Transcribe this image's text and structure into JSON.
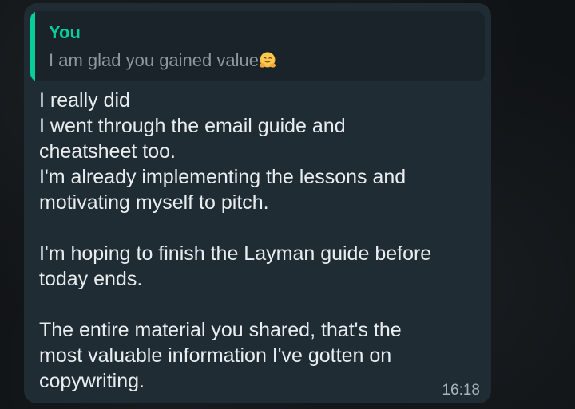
{
  "message": {
    "quoted": {
      "author": "You",
      "text": "I am glad you gained value",
      "emoji": "hugging-face-icon"
    },
    "body": {
      "line1": "I really did",
      "line2": "I went through the email guide and",
      "line3": "cheatsheet too.",
      "line4": "I'm already implementing the lessons and",
      "line5": "motivating myself to pitch.",
      "line6": "I'm hoping to finish the Layman guide before",
      "line7": "today ends.",
      "line8": "The entire material you shared, that's the",
      "line9": "most valuable information I've gotten on",
      "line10": "copywriting."
    },
    "time": "16:18"
  },
  "colors": {
    "bubble": "#1f2c34",
    "quote_background": "#1a2329",
    "quote_accent": "#06cf9c",
    "text": "#e9edef",
    "muted_text": "#8c979e"
  }
}
